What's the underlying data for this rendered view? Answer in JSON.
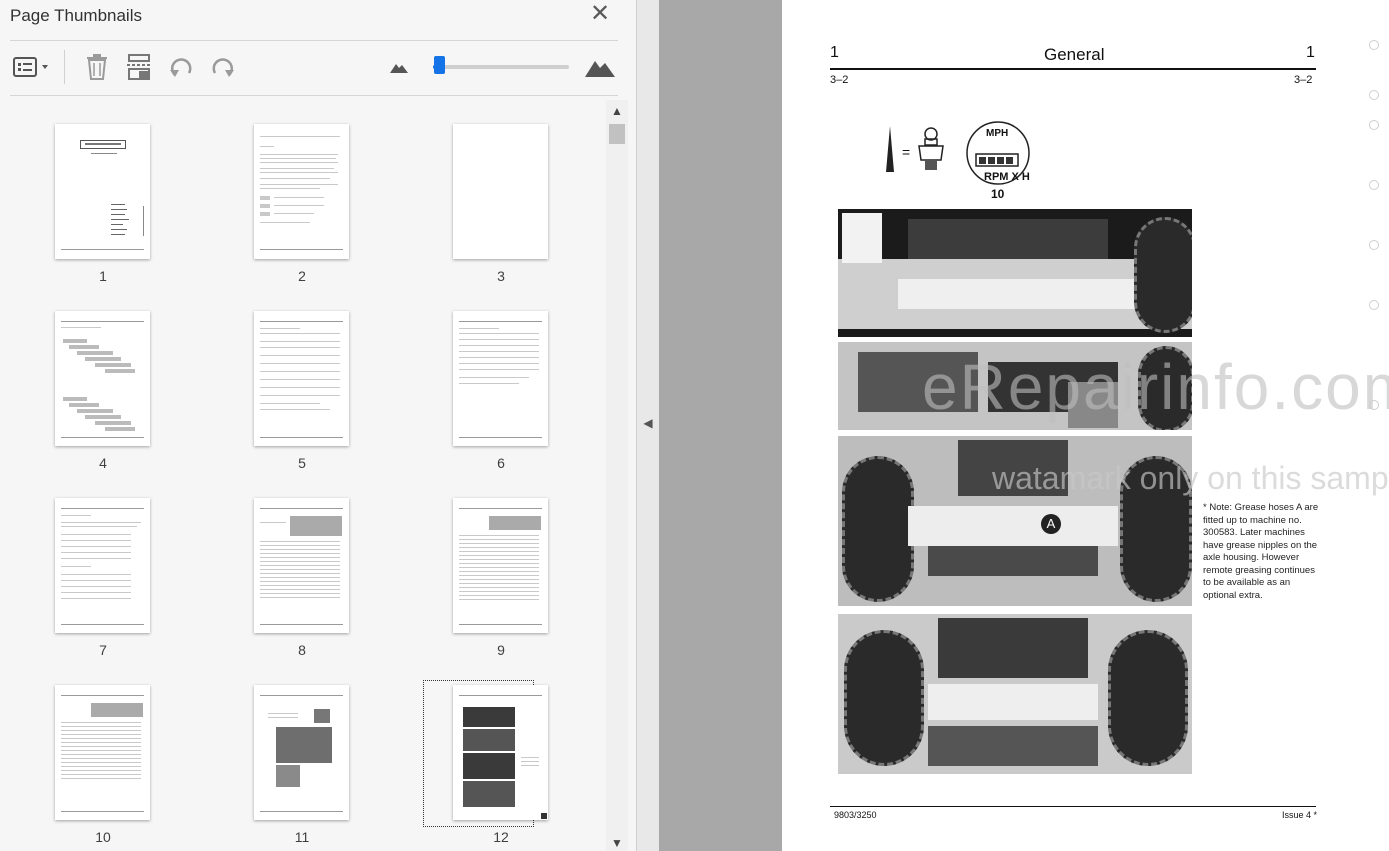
{
  "panel": {
    "title": "Page Thumbnails",
    "toolbar": {
      "options": "options-menu-icon",
      "delete": "trash-icon",
      "insert": "insert-pages-icon",
      "undo": "rotate-counterclockwise-icon",
      "redo": "rotate-clockwise-icon",
      "zoom_out": "small-mountain-icon",
      "zoom_in": "large-mountain-icon",
      "zoom_level": 0.05
    }
  },
  "thumbnails": [
    {
      "page": "1"
    },
    {
      "page": "2"
    },
    {
      "page": "3"
    },
    {
      "page": "4"
    },
    {
      "page": "5"
    },
    {
      "page": "6"
    },
    {
      "page": "7"
    },
    {
      "page": "8"
    },
    {
      "page": "9"
    },
    {
      "page": "10"
    },
    {
      "page": "11"
    },
    {
      "page": "12",
      "selected": true
    }
  ],
  "document": {
    "header_left": "1",
    "header_title": "General",
    "header_right": "1",
    "sub_left": "3–2",
    "sub_right": "3–2",
    "icon_equals": "=",
    "gauge_label_top": "MPH",
    "gauge_label_bottom": "RPM X H",
    "figure_number": "10",
    "callout_letter": "A",
    "note": "* Note: Grease hoses A are fitted up to machine no. 300583. Later machines have grease nipples on the axle housing. However remote greasing continues to be available as an optional extra.",
    "footer_left": "9803/3250",
    "footer_right": "Issue 4 *",
    "watermark_main": "eRepairinfo.com",
    "watermark_sub": "watamark only on this sample"
  }
}
